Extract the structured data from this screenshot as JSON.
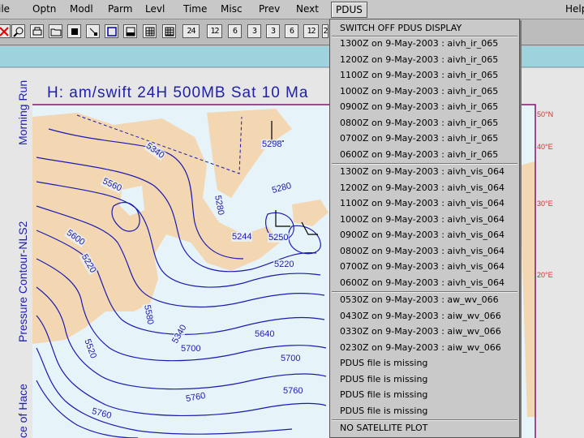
{
  "menubar": {
    "items": [
      "ile",
      "Optn",
      "Modl",
      "Parm",
      "Levl",
      "Time",
      "Misc",
      "Prev",
      "Next",
      "PDUS",
      "Help"
    ],
    "active": "PDUS"
  },
  "toolbar": {
    "icons": [
      "close-icon",
      "zoom-icon",
      "print-icon",
      "folder-icon",
      "fill-icon",
      "select-icon",
      "square-icon",
      "panel-icon",
      "grid-icon",
      "grid2-icon"
    ],
    "steps": [
      "24",
      "12",
      "6",
      "3",
      "3",
      "6",
      "12",
      "2"
    ]
  },
  "map": {
    "title": "H: am/swift 24H 500MB Sat 10 Ma",
    "side_labels": [
      "Morning Run",
      "Pressure Contour-NLS2",
      "ce of Hace"
    ],
    "contours": [
      "5340",
      "5298",
      "5560",
      "5280",
      "5280",
      "5244",
      "5250",
      "5600",
      "5220",
      "5220",
      "5580",
      "5340",
      "5640",
      "5700",
      "5700",
      "5760",
      "5760",
      "5760",
      "5520"
    ],
    "lat_labels": [
      "50°N",
      "40°E",
      "30°E",
      "20°E"
    ]
  },
  "pdus_menu": {
    "header": "SWITCH OFF PDUS DISPLAY",
    "ir_items": [
      "1300Z on  9-May-2003 : aivh_ir_065",
      "1200Z on  9-May-2003 : aivh_ir_065",
      "1100Z on  9-May-2003 : aivh_ir_065",
      "1000Z on  9-May-2003 : aivh_ir_065",
      "0900Z on  9-May-2003 : aivh_ir_065",
      "0800Z on  9-May-2003 : aivh_ir_065",
      "0700Z on  9-May-2003 : aivh_ir_065",
      "0600Z on  9-May-2003 : aivh_ir_065"
    ],
    "vis_items": [
      "1300Z on  9-May-2003 : aivh_vis_064",
      "1200Z on  9-May-2003 : aivh_vis_064",
      "1100Z on  9-May-2003 : aivh_vis_064",
      "1000Z on  9-May-2003 : aivh_vis_064",
      "0900Z on  9-May-2003 : aivh_vis_064",
      "0800Z on  9-May-2003 : aivh_vis_064",
      "0700Z on  9-May-2003 : aivh_vis_064",
      "0600Z on  9-May-2003 : aivh_vis_064"
    ],
    "wv_items": [
      "0530Z on  9-May-2003 : aw_wv_066",
      "0430Z on  9-May-2003 : aiw_wv_066",
      "0330Z on  9-May-2003 : aiw_wv_066",
      "0230Z on  9-May-2003 : aiw_wv_066",
      "PDUS file is missing",
      "PDUS file is missing",
      "PDUS file is missing",
      "PDUS file is missing"
    ],
    "footer": "NO SATELLITE PLOT"
  },
  "colors": {
    "land": "#f3d6b2",
    "sea": "#e6f4fa",
    "contour": "#1b1bb0",
    "strip": "#9ed3dd"
  }
}
